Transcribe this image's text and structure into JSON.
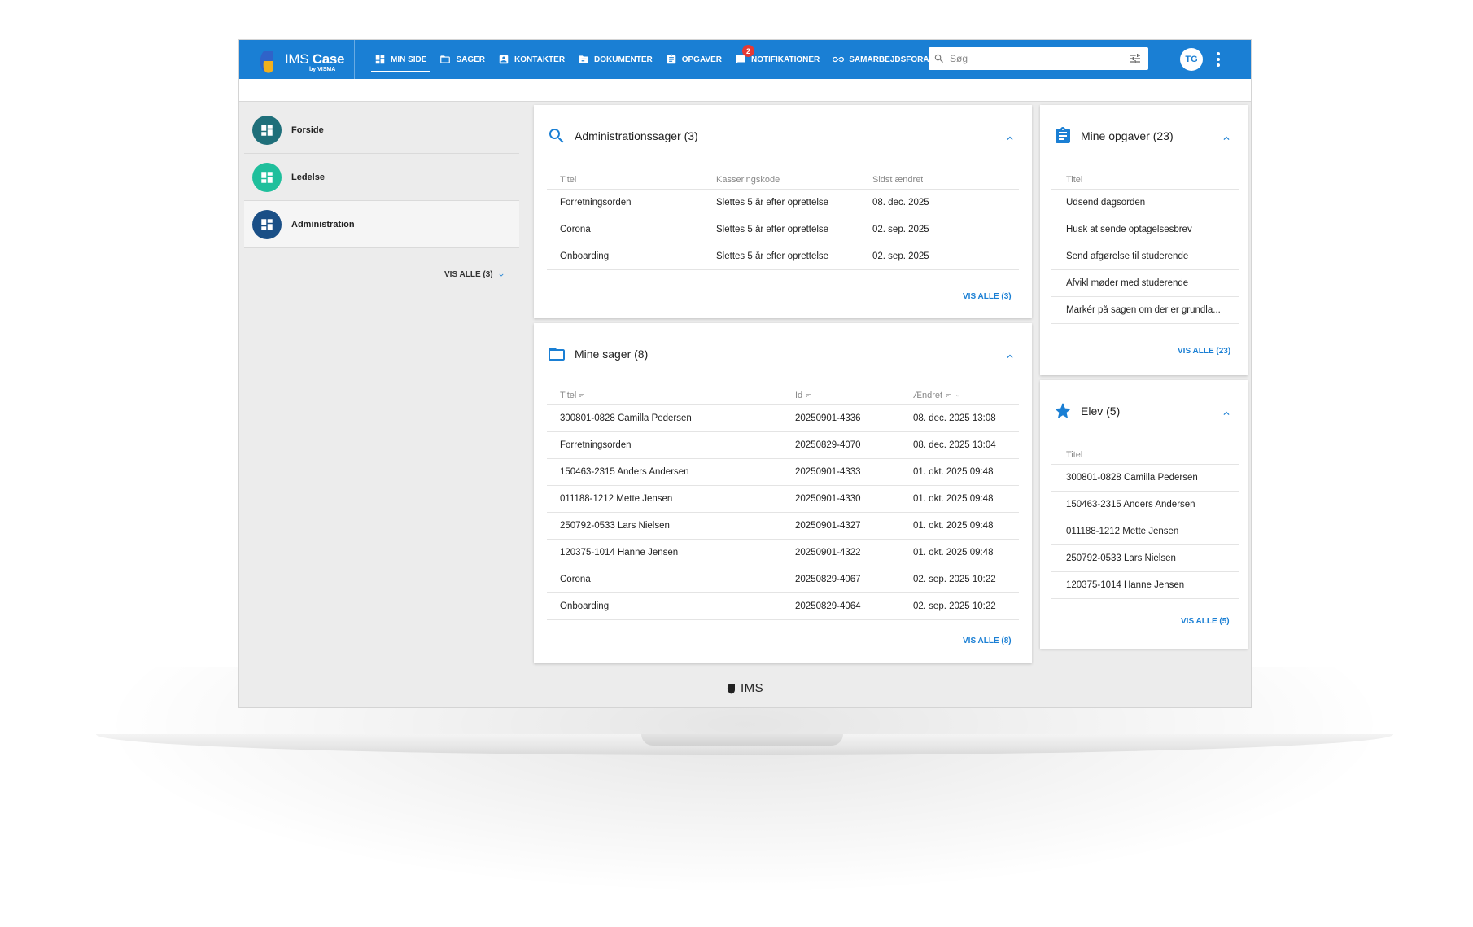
{
  "app": {
    "name_light": "IMS",
    "name_bold": "Case",
    "byline": "by VISMA",
    "brand_color": "#1a7fd4"
  },
  "nav": {
    "items": [
      {
        "label": "MIN SIDE",
        "icon": "dashboard-icon",
        "active": true
      },
      {
        "label": "SAGER",
        "icon": "folder-icon"
      },
      {
        "label": "KONTAKTER",
        "icon": "contact-card-icon"
      },
      {
        "label": "DOKUMENTER",
        "icon": "document-folder-icon"
      },
      {
        "label": "OPGAVER",
        "icon": "clipboard-icon"
      },
      {
        "label": "NOTIFIKATIONER",
        "icon": "notification-icon",
        "badge": "2"
      },
      {
        "label": "SAMARBEJDSFORA",
        "icon": "infinity-icon"
      }
    ]
  },
  "search": {
    "placeholder": "Søg"
  },
  "user": {
    "initials": "TG"
  },
  "sidebar": {
    "items": [
      {
        "label": "Forside",
        "color": "#1f6f7a"
      },
      {
        "label": "Ledelse",
        "color": "#1fbf9c"
      },
      {
        "label": "Administration",
        "color": "#1a4f86",
        "selected": true
      }
    ],
    "show_all": "VIS ALLE (3)"
  },
  "admin_cases": {
    "title": "Administrationssager (3)",
    "columns": [
      "Titel",
      "Kasseringskode",
      "Sidst ændret"
    ],
    "rows": [
      [
        "Forretningsorden",
        "Slettes 5 år efter oprettelse",
        "08. dec. 2025"
      ],
      [
        "Corona",
        "Slettes 5 år efter oprettelse",
        "02. sep. 2025"
      ],
      [
        "Onboarding",
        "Slettes 5 år efter oprettelse",
        "02. sep. 2025"
      ]
    ],
    "show_all": "VIS ALLE (3)"
  },
  "my_cases": {
    "title": "Mine sager (8)",
    "columns": [
      "Titel",
      "Id",
      "Ændret"
    ],
    "rows": [
      [
        "300801-0828 Camilla Pedersen",
        "20250901-4336",
        "08. dec. 2025 13:08"
      ],
      [
        "Forretningsorden",
        "20250829-4070",
        "08. dec. 2025 13:04"
      ],
      [
        "150463-2315 Anders Andersen",
        "20250901-4333",
        "01. okt. 2025 09:48"
      ],
      [
        "011188-1212 Mette Jensen",
        "20250901-4330",
        "01. okt. 2025 09:48"
      ],
      [
        "250792-0533 Lars Nielsen",
        "20250901-4327",
        "01. okt. 2025 09:48"
      ],
      [
        "120375-1014 Hanne Jensen",
        "20250901-4322",
        "01. okt. 2025 09:48"
      ],
      [
        "Corona",
        "20250829-4067",
        "02. sep. 2025 10:22"
      ],
      [
        "Onboarding",
        "20250829-4064",
        "02. sep. 2025 10:22"
      ]
    ],
    "show_all": "VIS ALLE (8)"
  },
  "my_tasks": {
    "title": "Mine opgaver (23)",
    "column": "Titel",
    "rows": [
      "Udsend dagsorden",
      "Husk at sende optagelsesbrev",
      "Send afgørelse til studerende",
      "Afvikl møder med studerende",
      "Markér på sagen om der er grundla..."
    ],
    "show_all": "VIS ALLE (23)"
  },
  "students": {
    "title": "Elev (5)",
    "column": "Titel",
    "rows": [
      "300801-0828 Camilla Pedersen",
      "150463-2315 Anders Andersen",
      "011188-1212 Mette Jensen",
      "250792-0533 Lars Nielsen",
      "120375-1014 Hanne Jensen"
    ],
    "show_all": "VIS ALLE (5)"
  },
  "footer": {
    "logo_text": "IMS"
  }
}
